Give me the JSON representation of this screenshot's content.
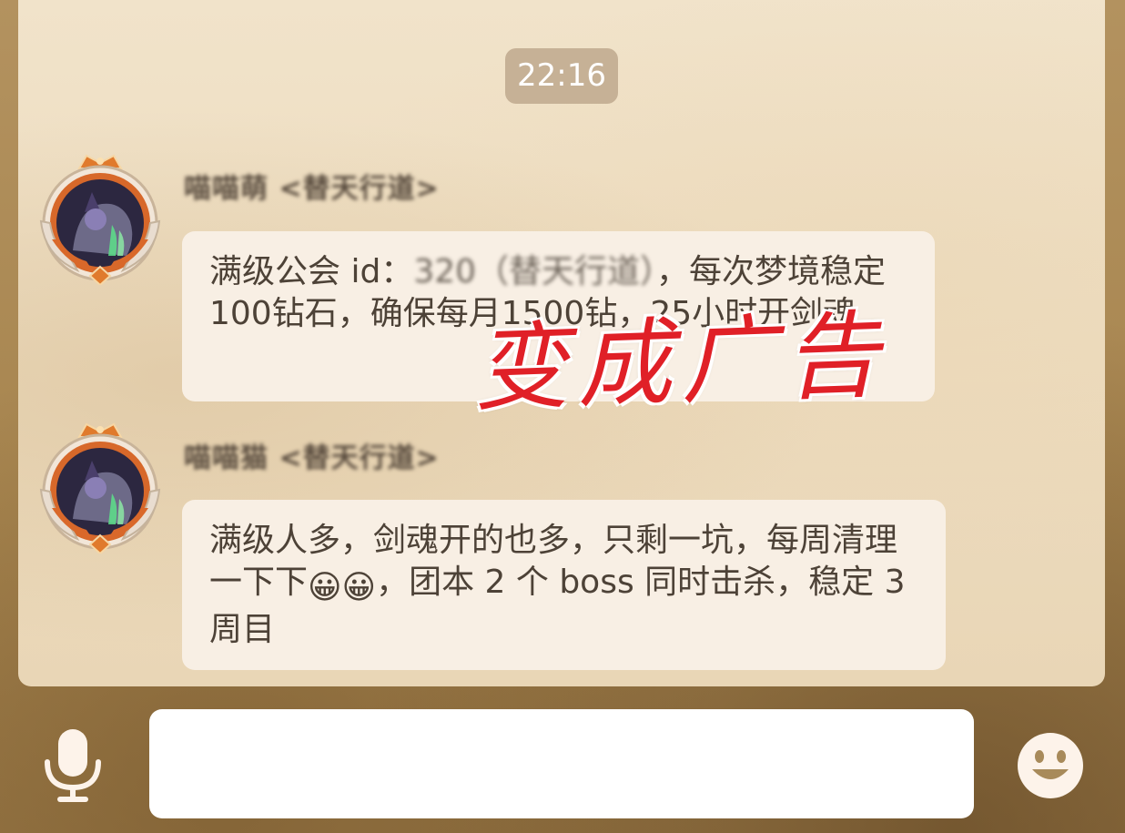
{
  "chat": {
    "timestamp": "22:16",
    "messages": [
      {
        "sender": "喵喵萌 <替天行道>",
        "text_before": "满级公会 id：",
        "blurred_part": "320（替天行道）",
        "text_after": "，每次梦境稳定100钻石，确保每月1500钻，25小时开剑魂",
        "avatar_icon": "character-avatar-icon"
      },
      {
        "sender": "喵喵猫 <替天行道>",
        "text_part1": "满级人多，剑魂开的也多，只剩一坑，每周清理一下下",
        "emoji1": "😀",
        "emoji2": "😀",
        "text_part2": "，团本 2 个 boss 同时击杀，稳定 3 周目",
        "avatar_icon": "character-avatar-icon"
      }
    ]
  },
  "overlay": {
    "watermark_text": "变成广告"
  },
  "input": {
    "value": "",
    "placeholder": "",
    "mic_icon": "microphone-icon",
    "emoji_icon": "smiley-face-icon"
  },
  "colors": {
    "bubble_bg": "#f8efe4",
    "timestamp_bg": "#c6b196",
    "watermark": "#e02027",
    "icon": "#fdf3ea"
  }
}
